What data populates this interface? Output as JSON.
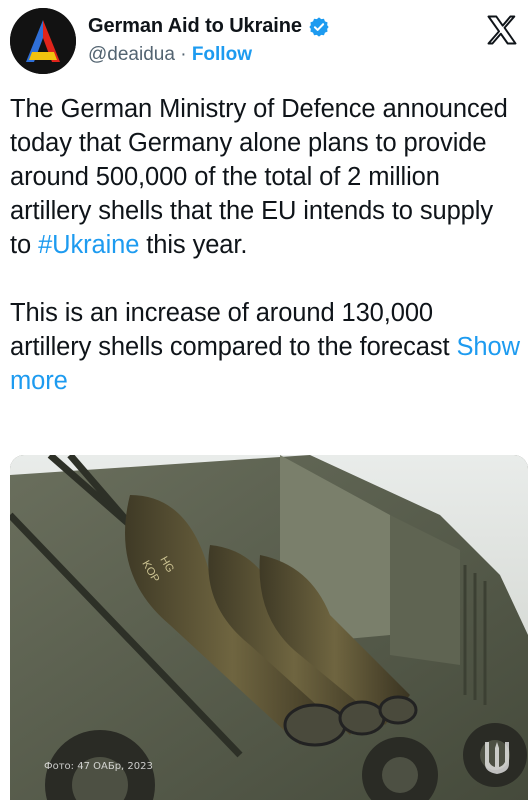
{
  "account": {
    "display_name": "German Aid to Ukraine",
    "handle": "@deaidua",
    "separator": "·",
    "follow_label": "Follow"
  },
  "tweet": {
    "paragraph1_before": "The German Ministry of Defence announced today that Germany alone plans to provide around 500,000 of the total of 2 million artillery shells that the EU intends to supply to ",
    "hashtag": "#Ukraine",
    "paragraph1_after": " this year.",
    "paragraph2": "This is an increase of around 130,000 artillery shells compared to the forecast",
    "show_more": "Show more"
  },
  "media": {
    "photo_credit": "Фото: 47 ОАБр, 2023",
    "shell_markings": [
      "KOP",
      "HG"
    ]
  },
  "icons": {
    "verified": "verified-badge-icon",
    "platform": "x-logo-icon",
    "watermark": "trident-icon"
  },
  "colors": {
    "accent": "#1d9bf0",
    "text": "#0f1419",
    "muted": "#536471"
  }
}
